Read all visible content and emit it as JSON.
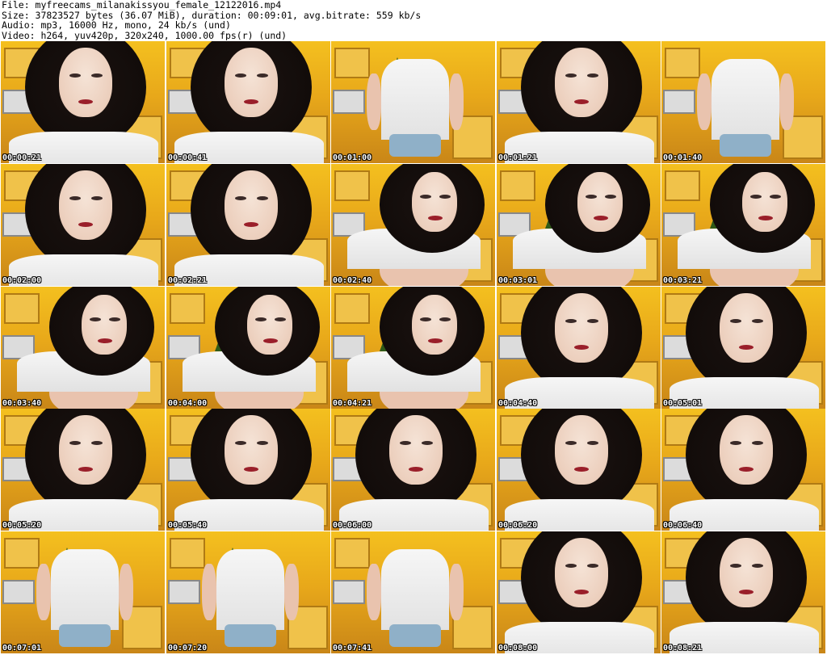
{
  "header": {
    "file_line": "File: myfreecams_milanakissyou_female_12122016.mp4",
    "size_line": "Size: 37823527 bytes (36.07 MiB), duration: 00:09:01, avg.bitrate: 559 kb/s",
    "audio_line": "Audio: mp3, 16000 Hz, mono, 24 kb/s (und)",
    "video_line": "Video: h264, yuv420p, 320x240, 1000.00 fps(r) (und)"
  },
  "grid": {
    "columns": 5,
    "rows": 5
  },
  "thumbnails": [
    {
      "timestamp": "00:00:21",
      "scene": "closeup"
    },
    {
      "timestamp": "00:00:41",
      "scene": "closeup"
    },
    {
      "timestamp": "00:01:00",
      "scene": "standing"
    },
    {
      "timestamp": "00:01:21",
      "scene": "closeup"
    },
    {
      "timestamp": "00:01:40",
      "scene": "standing"
    },
    {
      "timestamp": "00:02:00",
      "scene": "closeup"
    },
    {
      "timestamp": "00:02:21",
      "scene": "closeup"
    },
    {
      "timestamp": "00:02:40",
      "scene": "kneeling"
    },
    {
      "timestamp": "00:03:01",
      "scene": "kneeling"
    },
    {
      "timestamp": "00:03:21",
      "scene": "kneeling"
    },
    {
      "timestamp": "00:03:40",
      "scene": "kneeling"
    },
    {
      "timestamp": "00:04:00",
      "scene": "kneeling"
    },
    {
      "timestamp": "00:04:21",
      "scene": "kneeling"
    },
    {
      "timestamp": "00:04:40",
      "scene": "closeup"
    },
    {
      "timestamp": "00:05:01",
      "scene": "closeup"
    },
    {
      "timestamp": "00:05:20",
      "scene": "closeup"
    },
    {
      "timestamp": "00:05:40",
      "scene": "closeup"
    },
    {
      "timestamp": "00:06:00",
      "scene": "closeup"
    },
    {
      "timestamp": "00:06:20",
      "scene": "closeup"
    },
    {
      "timestamp": "00:06:40",
      "scene": "closeup"
    },
    {
      "timestamp": "00:07:01",
      "scene": "standing"
    },
    {
      "timestamp": "00:07:20",
      "scene": "standing"
    },
    {
      "timestamp": "00:07:41",
      "scene": "standing"
    },
    {
      "timestamp": "00:08:00",
      "scene": "closeup"
    },
    {
      "timestamp": "00:08:21",
      "scene": "closeup"
    }
  ],
  "colors": {
    "background": "#ffffff",
    "header_text": "#000000",
    "timestamp_text": "#ffffff",
    "timestamp_outline": "#000000",
    "kitchen_yellow": "#f4c01f",
    "hair": "#120c0a",
    "shirt": "#f0f0f0",
    "lips": "#9a1f2a"
  }
}
